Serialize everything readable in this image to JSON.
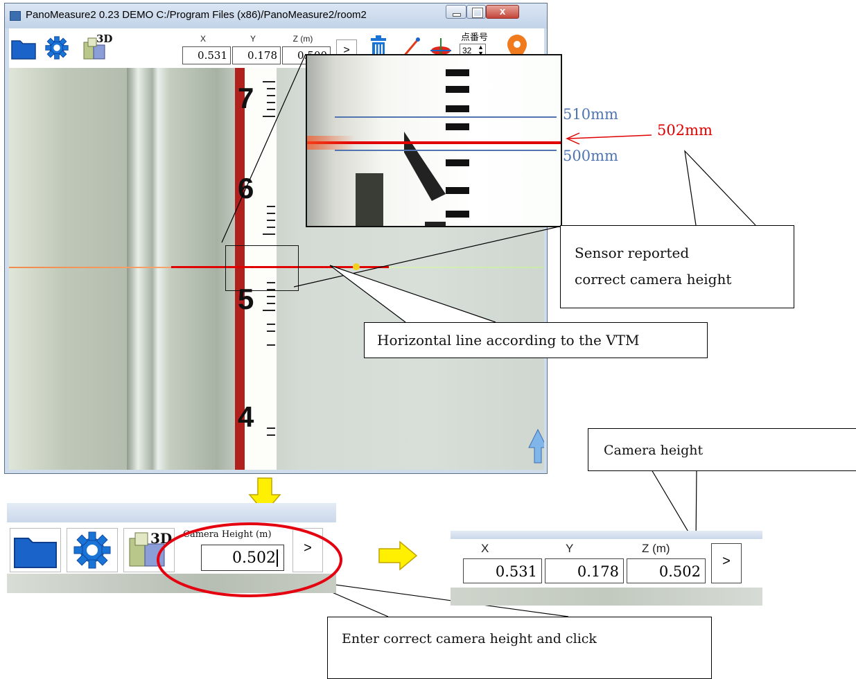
{
  "window": {
    "title": "PanoMeasure2 0.23 DEMO  C:/Program Files (x86)/PanoMeasure2/room2",
    "close_glyph": "x"
  },
  "toolbar": {
    "icons": [
      "folder-icon",
      "gear-icon",
      "3d-view-icon",
      "trash-icon",
      "line-measure-icon",
      "horizon-icon",
      "location-pin-icon"
    ],
    "three_d_label": "3D",
    "x_label": "X",
    "y_label": "Y",
    "z_label": "Z (m)",
    "x_value": "0.531",
    "y_value": "0.178",
    "z_value": "0.500",
    "next_label": ">",
    "point_label": "点番号",
    "point_value": "32"
  },
  "ruler_numbers": [
    "7",
    "6",
    "5",
    "4"
  ],
  "zoom": {
    "upper_label": "510mm",
    "lower_label": "500mm",
    "reported_label": "502mm"
  },
  "callouts": {
    "sensor": "Sensor reported correct camera height",
    "sensor_line1": "Sensor reported",
    "sensor_line2": "correct camera height",
    "horizontal": "Horizontal line according to the VTM",
    "camera_height": "Camera height",
    "enter": "Enter correct camera height and click"
  },
  "step1": {
    "three_d_label": "3D",
    "camera_height_label": "Camera Height (m)",
    "camera_height_value": "0.502",
    "next_label": ">"
  },
  "step2": {
    "x_label": "X",
    "y_label": "Y",
    "z_label": "Z (m)",
    "x_value": "0.531",
    "y_value": "0.178",
    "z_value": "0.502",
    "next_label": ">"
  },
  "colors": {
    "measure_red": "#e00000",
    "guide_blue": "#4f74b0",
    "folder_blue": "#1a63c8",
    "arrow_yellow": "#ffef00",
    "highlight_red": "#e4000f"
  }
}
